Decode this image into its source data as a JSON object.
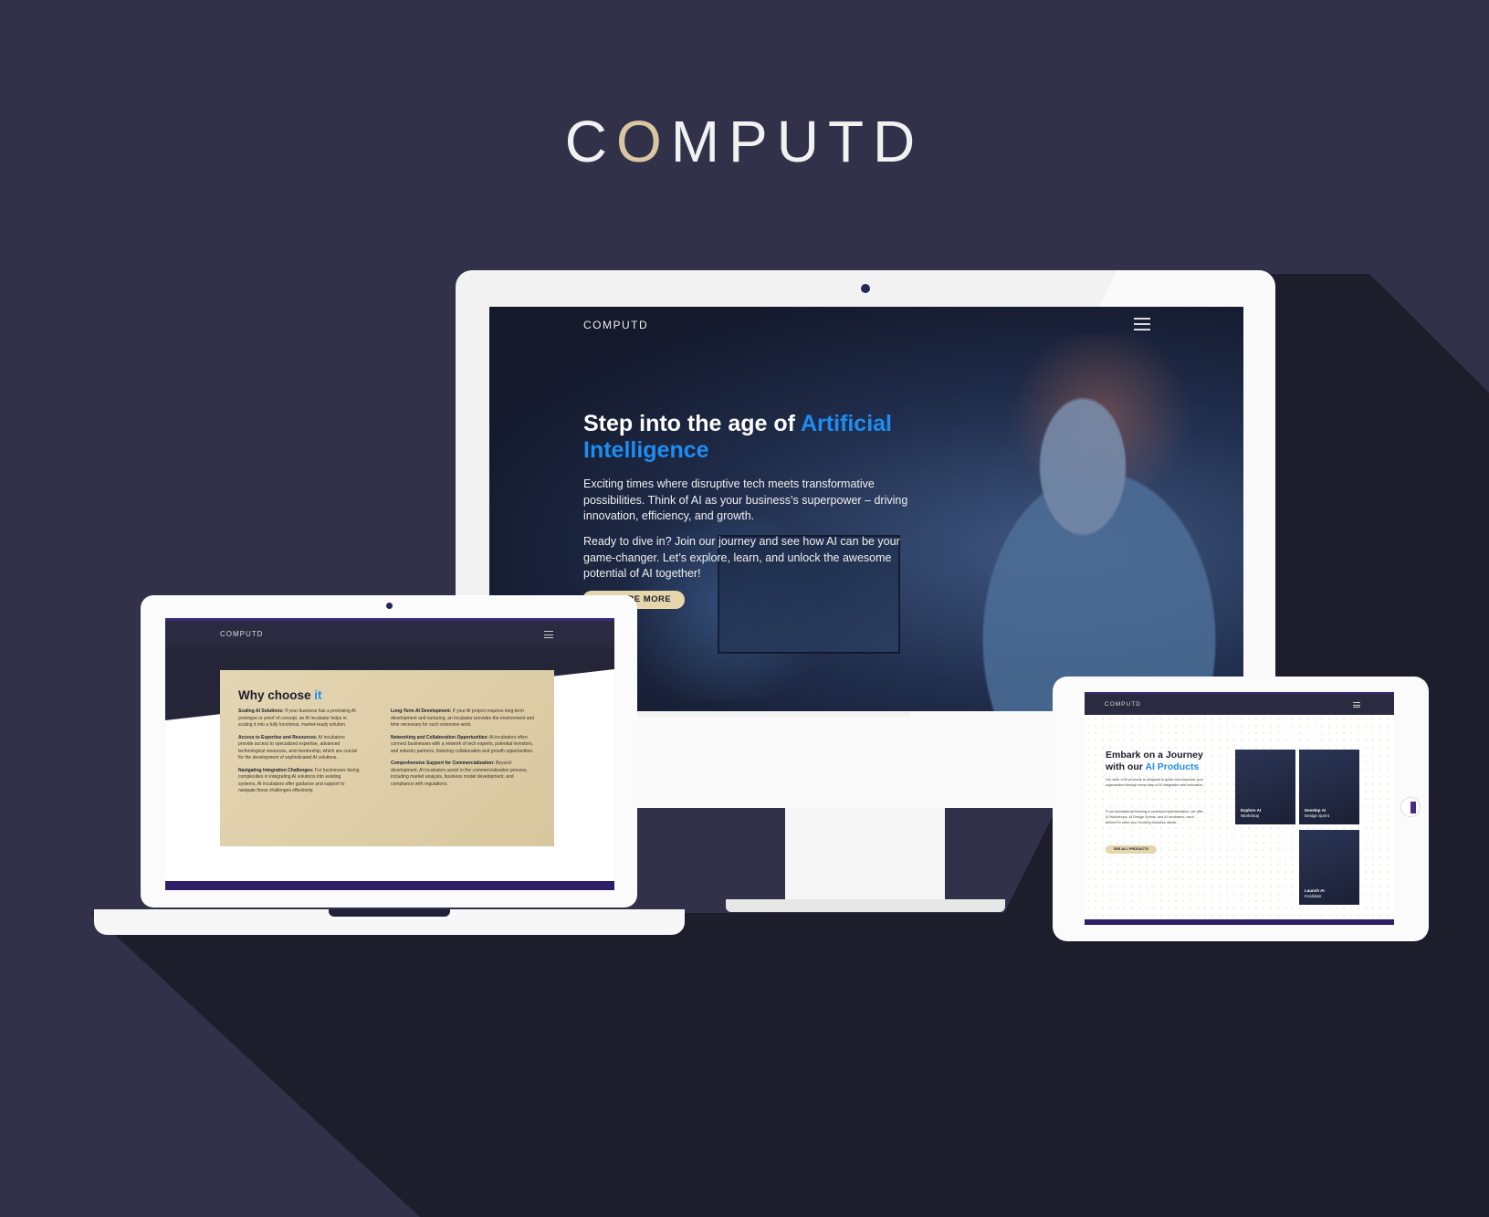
{
  "brand": {
    "logo_text_pre": "C",
    "logo_text_o": "O",
    "logo_text_post": "MPUTD"
  },
  "monitor": {
    "nav_logo": "COMPUTD",
    "hero_title_pre": "Step into the age of ",
    "hero_title_accent": "Artificial Intelligence",
    "hero_p1": "Exciting times where disruptive tech meets transformative possibilities. Think of AI as your business’s superpower – driving innovation, efficiency, and growth.",
    "hero_p2": "Ready to dive in? Join our journey and see how AI can be your game-changer. Let’s explore, learn, and unlock the awesome potential of AI together!",
    "cta_label": "EXPLORE MORE"
  },
  "laptop": {
    "nav_logo": "COMPUTD",
    "card_title_pre": "Why choose ",
    "card_title_accent": "it",
    "left_items": [
      {
        "title": "Scaling AI Solutions:",
        "text": " If your business has a promising AI prototype or proof of concept, an AI incubator helps in scaling it into a fully functional, market-ready solution."
      },
      {
        "title": "Access to Expertise and Resources:",
        "text": " AI incubators provide access to specialized expertise, advanced technological resources, and mentorship, which are crucial for the development of sophisticated AI solutions."
      },
      {
        "title": "Navigating Integration Challenges:",
        "text": " For businesses facing complexities in integrating AI solutions into existing systems, AI incubators offer guidance and support to navigate these challenges effectively."
      }
    ],
    "right_items": [
      {
        "title": "Long-Term AI Development:",
        "text": " If your AI project requires long-term development and nurturing, an incubator provides the environment and time necessary for such extensive work."
      },
      {
        "title": "Networking and Collaboration Opportunities:",
        "text": " AI incubators often connect businesses with a network of tech experts, potential investors, and industry partners, fostering collaboration and growth opportunities."
      },
      {
        "title": "Comprehensive Support for Commercialization:",
        "text": " Beyond development, AI incubators assist in the commercialization process, including market analysis, business model development, and compliance with regulations."
      }
    ]
  },
  "tablet": {
    "nav_logo": "COMPUTD",
    "title_pre": "Embark on a Journey with our ",
    "title_accent": "AI Products",
    "p1": "Our suite of AI products is designed to guide and empower your organization through every step of AI integration and innovation.",
    "p2": "From foundational learning to practical implementation, we offer AI Workshops, AI Design Sprints, and AI Incubators, each tailored to meet your evolving business needs.",
    "cta_label": "SEE ALL PRODUCTS",
    "tiles": [
      {
        "line1": "Explore AI",
        "line2": "Workshop"
      },
      {
        "line1": "Develop AI",
        "line2": "Design Sprint"
      },
      {
        "line1": "Launch AI",
        "line2": "Incubator"
      }
    ]
  },
  "colors": {
    "background": "#313149",
    "accent_blue": "#1f8cf2",
    "gold": "#e6d6ac",
    "purple_bar": "#2c1f66"
  }
}
